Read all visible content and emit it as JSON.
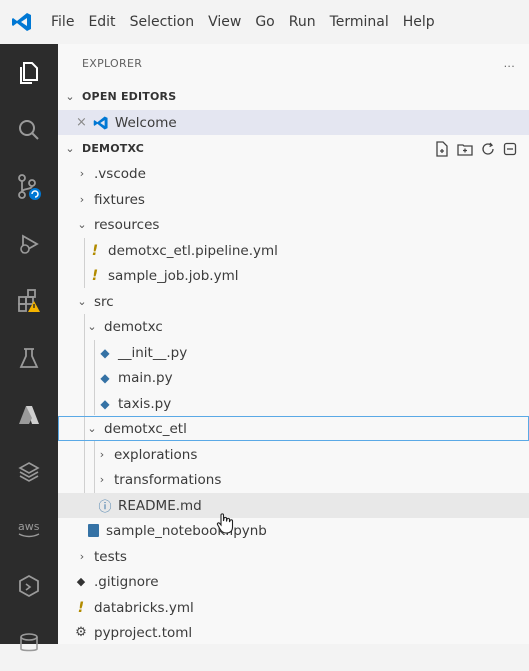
{
  "menu": [
    "File",
    "Edit",
    "Selection",
    "View",
    "Go",
    "Run",
    "Terminal",
    "Help"
  ],
  "explorer": {
    "title": "EXPLORER",
    "more": "..."
  },
  "open_editors": {
    "label": "OPEN EDITORS",
    "items": [
      {
        "close": "×",
        "label": "Welcome"
      }
    ]
  },
  "workspace": {
    "label": "DEMOTXC"
  },
  "tree": [
    {
      "label": ".vscode",
      "kind": "folder-closed"
    },
    {
      "label": "fixtures",
      "kind": "folder-closed"
    },
    {
      "label": "resources",
      "kind": "folder-open"
    },
    {
      "label": "demotxc_etl.pipeline.yml",
      "kind": "yml"
    },
    {
      "label": "sample_job.job.yml",
      "kind": "yml"
    },
    {
      "label": "src",
      "kind": "folder-open"
    },
    {
      "label": "demotxc",
      "kind": "folder-open"
    },
    {
      "label": "__init__.py",
      "kind": "py"
    },
    {
      "label": "main.py",
      "kind": "py"
    },
    {
      "label": "taxis.py",
      "kind": "py"
    },
    {
      "label": "demotxc_etl",
      "kind": "folder-open"
    },
    {
      "label": "explorations",
      "kind": "folder-closed"
    },
    {
      "label": "transformations",
      "kind": "folder-closed"
    },
    {
      "label": "README.md",
      "kind": "md"
    },
    {
      "label": "sample_notebook.ipynb",
      "kind": "nb"
    },
    {
      "label": "tests",
      "kind": "folder-closed"
    },
    {
      "label": ".gitignore",
      "kind": "git"
    },
    {
      "label": "databricks.yml",
      "kind": "yml"
    },
    {
      "label": "pyproject.toml",
      "kind": "toml"
    }
  ],
  "colors": {
    "activity_bar": "#2c2c2c",
    "accent": "#0078d4",
    "selection": "#e4e6f1",
    "warning_badge": "#f5b400"
  }
}
